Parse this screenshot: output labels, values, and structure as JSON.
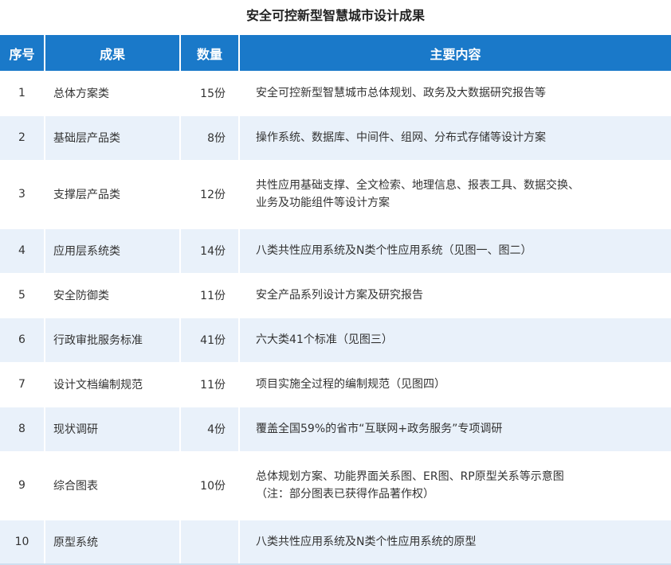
{
  "title": "安全可控新型智慧城市设计成果",
  "headers": {
    "no": "序号",
    "result": "成果",
    "qty": "数量",
    "content": "主要内容"
  },
  "rows": [
    {
      "no": "1",
      "result": "总体方案类",
      "qty": "15份",
      "content": [
        "安全可控新型智慧城市总体规划、政务及大数据研究报告等"
      ]
    },
    {
      "no": "2",
      "result": "基础层产品类",
      "qty": "8份",
      "content": [
        "操作系统、数据库、中间件、组网、分布式存储等设计方案"
      ]
    },
    {
      "no": "3",
      "result": "支撑层产品类",
      "qty": "12份",
      "content": [
        "共性应用基础支撑、全文检索、地理信息、报表工具、数据交换、",
        "业务及功能组件等设计方案"
      ]
    },
    {
      "no": "4",
      "result": "应用层系统类",
      "qty": "14份",
      "content": [
        "八类共性应用系统及N类个性应用系统（见图一、图二）"
      ]
    },
    {
      "no": "5",
      "result": "安全防御类",
      "qty": "11份",
      "content": [
        "安全产品系列设计方案及研究报告"
      ]
    },
    {
      "no": "6",
      "result": "行政审批服务标准",
      "qty": "41份",
      "content": [
        "六大类41个标准（见图三）"
      ]
    },
    {
      "no": "7",
      "result": "设计文档编制规范",
      "qty": "11份",
      "content": [
        "项目实施全过程的编制规范（见图四）"
      ]
    },
    {
      "no": "8",
      "result": "现状调研",
      "qty": "4份",
      "content": [
        "覆盖全国59%的省市“互联网+政务服务”专项调研"
      ]
    },
    {
      "no": "9",
      "result": "综合图表",
      "qty": "10份",
      "content": [
        "总体规划方案、功能界面关系图、ER图、RP原型关系等示意图",
        "（注：部分图表已获得作品著作权）"
      ]
    },
    {
      "no": "10",
      "result": "原型系统",
      "qty": "",
      "content": [
        "八类共性应用系统及N类个性应用系统的原型"
      ]
    }
  ],
  "colors": {
    "header_bg": "#1a79c9",
    "stripe_bg": "#e9f1fa"
  }
}
